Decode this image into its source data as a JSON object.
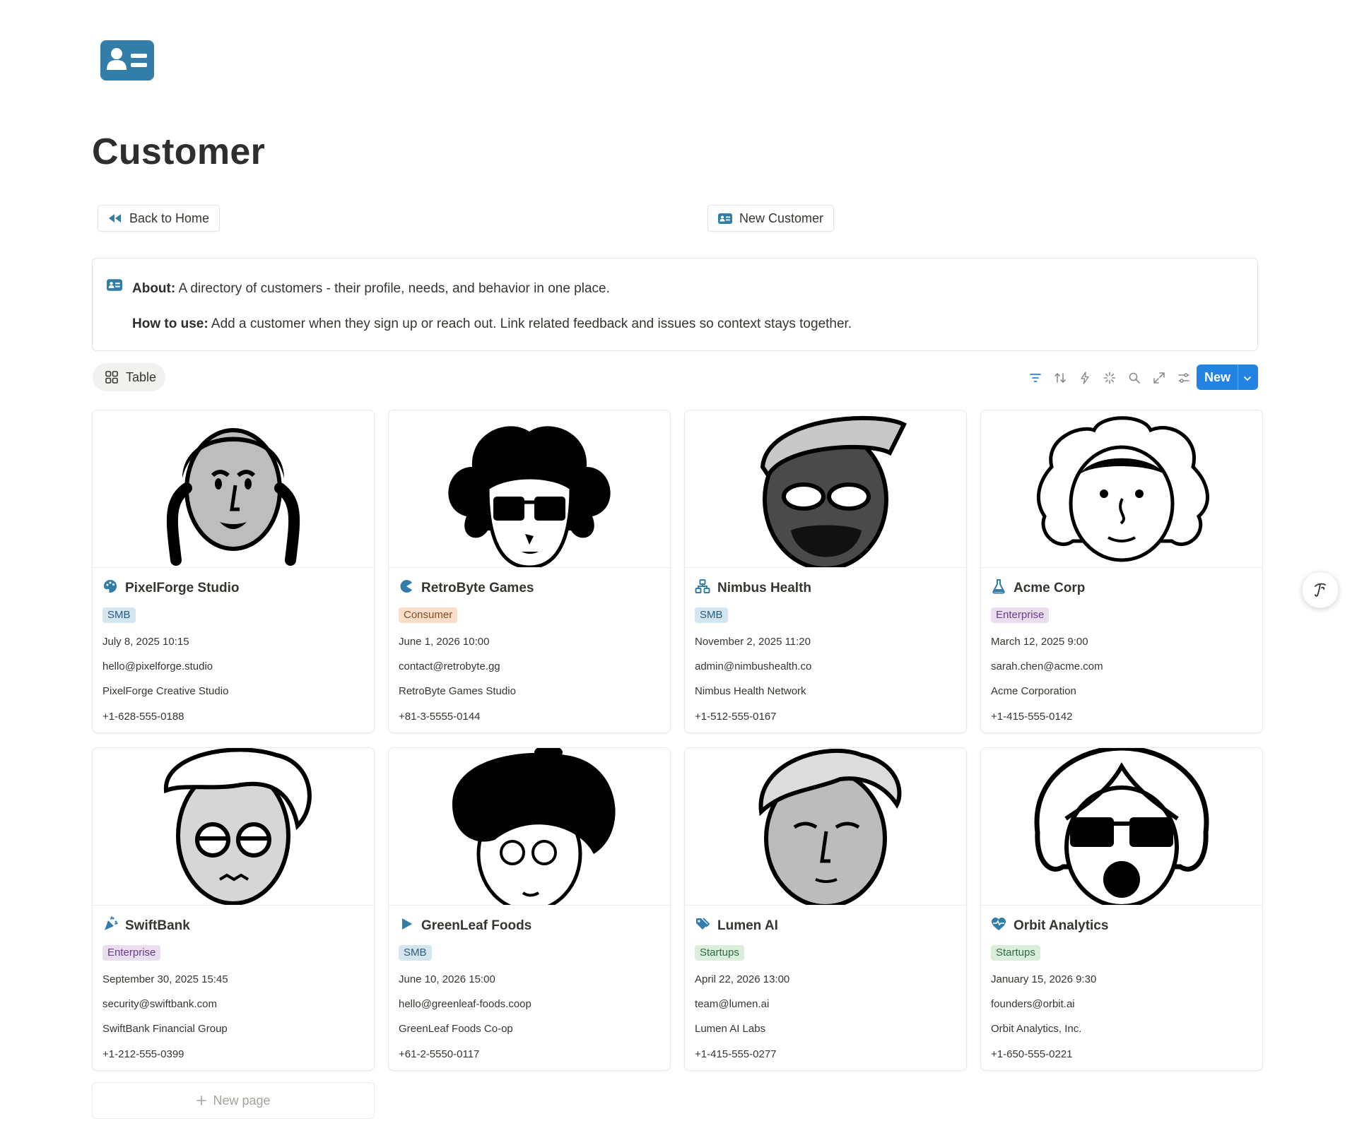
{
  "page": {
    "title": "Customer",
    "icon": "contact-card-icon",
    "accent_color": "#337ea9"
  },
  "buttons": {
    "back_label": "Back to Home",
    "back_icon": "rewind-icon",
    "new_customer_label": "New Customer",
    "new_customer_icon": "contact-card-icon"
  },
  "callout": {
    "about_label": "About:",
    "about_text": "A directory of customers - their profile, needs, and behavior in one place.",
    "howto_label": "How to use:",
    "howto_text": "Add a customer when they sign up or reach out. Link related feedback and issues so context stays together."
  },
  "view": {
    "tab_label": "Table",
    "tab_icon": "grid-icon"
  },
  "toolbar": {
    "icons": [
      "filter-icon",
      "sort-icon",
      "automation-icon",
      "sparkle-icon",
      "search-icon",
      "expand-icon",
      "settings-icon"
    ],
    "new_label": "New",
    "primary_color": "#2383e2"
  },
  "cards": [
    {
      "name": "PixelForge Studio",
      "icon": "palette-icon",
      "tag": "SMB",
      "tag_style": "smb",
      "date": "July 8, 2025 10:15",
      "email": "hello@pixelforge.studio",
      "company": "PixelForge Creative Studio",
      "phone": "+1-628-555-0188"
    },
    {
      "name": "RetroByte Games",
      "icon": "pacman-icon",
      "tag": "Consumer",
      "tag_style": "consumer",
      "date": "June 1, 2026 10:00",
      "email": "contact@retrobyte.gg",
      "company": "RetroByte Games Studio",
      "phone": "+81-3-5555-0144"
    },
    {
      "name": "Nimbus Health",
      "icon": "network-icon",
      "tag": "SMB",
      "tag_style": "smb",
      "date": "November 2, 2025 11:20",
      "email": "admin@nimbushealth.co",
      "company": "Nimbus Health Network",
      "phone": "+1-512-555-0167"
    },
    {
      "name": "Acme Corp",
      "icon": "flask-icon",
      "tag": "Enterprise",
      "tag_style": "enterprise",
      "date": "March 12, 2025 9:00",
      "email": "sarah.chen@acme.com",
      "company": "Acme Corporation",
      "phone": "+1-415-555-0142"
    },
    {
      "name": "SwiftBank",
      "icon": "party-popper-icon",
      "tag": "Enterprise",
      "tag_style": "enterprise",
      "date": "September 30, 2025 15:45",
      "email": "security@swiftbank.com",
      "company": "SwiftBank Financial Group",
      "phone": "+1-212-555-0399"
    },
    {
      "name": "GreenLeaf Foods",
      "icon": "play-icon",
      "tag": "SMB",
      "tag_style": "smb",
      "date": "June 10, 2026 15:00",
      "email": "hello@greenleaf-foods.coop",
      "company": "GreenLeaf Foods Co-op",
      "phone": "+61-2-5550-0117"
    },
    {
      "name": "Lumen AI",
      "icon": "tags-icon",
      "tag": "Startups",
      "tag_style": "startups",
      "date": "April 22, 2026 13:00",
      "email": "team@lumen.ai",
      "company": "Lumen AI Labs",
      "phone": "+1-415-555-0277"
    },
    {
      "name": "Orbit Analytics",
      "icon": "heart-pulse-icon",
      "tag": "Startups",
      "tag_style": "startups",
      "date": "January 15, 2026 9:30",
      "email": "founders@orbit.ai",
      "company": "Orbit Analytics, Inc.",
      "phone": "+1-650-555-0221"
    }
  ],
  "new_page": {
    "label": "New page"
  },
  "ai_button_icon": "notion-ai-icon"
}
